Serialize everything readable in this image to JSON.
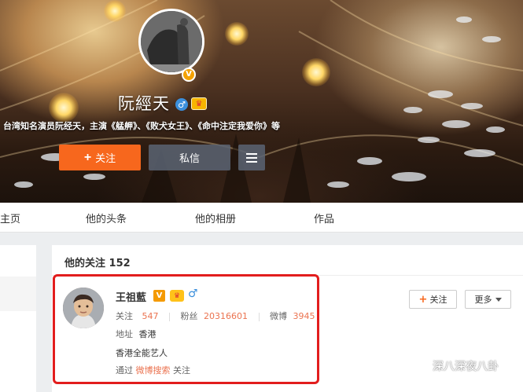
{
  "profile": {
    "name": "阮經天",
    "bio": "台湾知名演员阮经天，主演《艋舺》、《败犬女王》、《命中注定我爱你》等",
    "verified_badge": "V",
    "gender_symbol": "♂",
    "follow_label": "关注",
    "message_label": "私信"
  },
  "nav": {
    "tabs": [
      "主页",
      "他的头条",
      "他的相册",
      "作品"
    ]
  },
  "following": {
    "title": "他的关注 152",
    "user": {
      "name": "王祖藍",
      "verified_badge": "V",
      "gender_symbol": "♂",
      "follow_label": "关注",
      "follow_count": "547",
      "fans_label": "粉丝",
      "fans_count": "20316601",
      "weibo_label": "微博",
      "weibo_count": "3945",
      "address_label": "地址",
      "address_value": "香港",
      "intro": "香港全能艺人",
      "via_prefix": "通过",
      "via_link": "微博搜索",
      "via_suffix": "关注"
    },
    "follow_button": "关注",
    "more_button": "更多"
  },
  "watermark": "深八深夜八卦",
  "colors": {
    "orange": "#f7671d",
    "highlight_red": "#e21d1d",
    "stat_number": "#eb7350",
    "male_blue": "#3b8fdc"
  }
}
